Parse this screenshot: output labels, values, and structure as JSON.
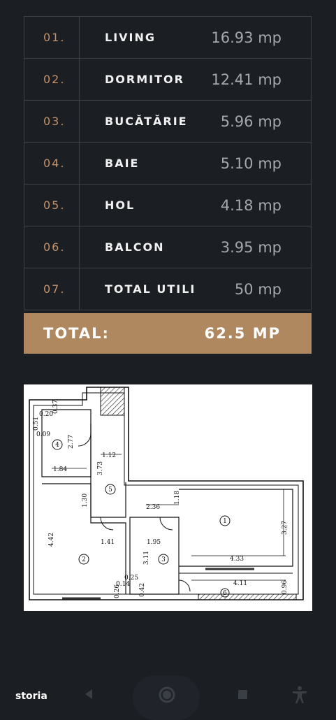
{
  "rooms": [
    {
      "num": "01.",
      "name": "LIVING",
      "area": "16.93 mp"
    },
    {
      "num": "02.",
      "name": "DORMITOR",
      "area": "12.41 mp"
    },
    {
      "num": "03.",
      "name": "BUCĂTĂRIE",
      "area": "5.96 mp"
    },
    {
      "num": "04.",
      "name": "BAIE",
      "area": "5.10 mp"
    },
    {
      "num": "05.",
      "name": "HOL",
      "area": "4.18 mp"
    },
    {
      "num": "06.",
      "name": "BALCON",
      "area": "3.95 mp"
    },
    {
      "num": "07.",
      "name": "TOTAL UTILI",
      "area": "50 mp"
    }
  ],
  "total": {
    "label": "TOTAL:",
    "value": "62.5 MP"
  },
  "floorplan": {
    "room_numbers": [
      "1",
      "2",
      "3",
      "4",
      "5",
      "6"
    ],
    "dimensions": [
      "0.20",
      "0.37",
      "0.51",
      "0.09",
      "2.77",
      "1.84",
      "1.12",
      "3.73",
      "1.30",
      "1.18",
      "2.36",
      "4.42",
      "1.41",
      "1.95",
      "3.11",
      "3.27",
      "4.33",
      "4.11",
      "0.25",
      "0.14",
      "0.26",
      "0.42",
      "0.96"
    ]
  },
  "brand": {
    "name": "storia"
  },
  "colors": {
    "background": "#1b1e23",
    "accent": "#b08860",
    "number": "#c4926a"
  },
  "nav": {
    "icons": [
      "back-icon",
      "home-icon",
      "recents-icon",
      "accessibility-icon"
    ]
  }
}
